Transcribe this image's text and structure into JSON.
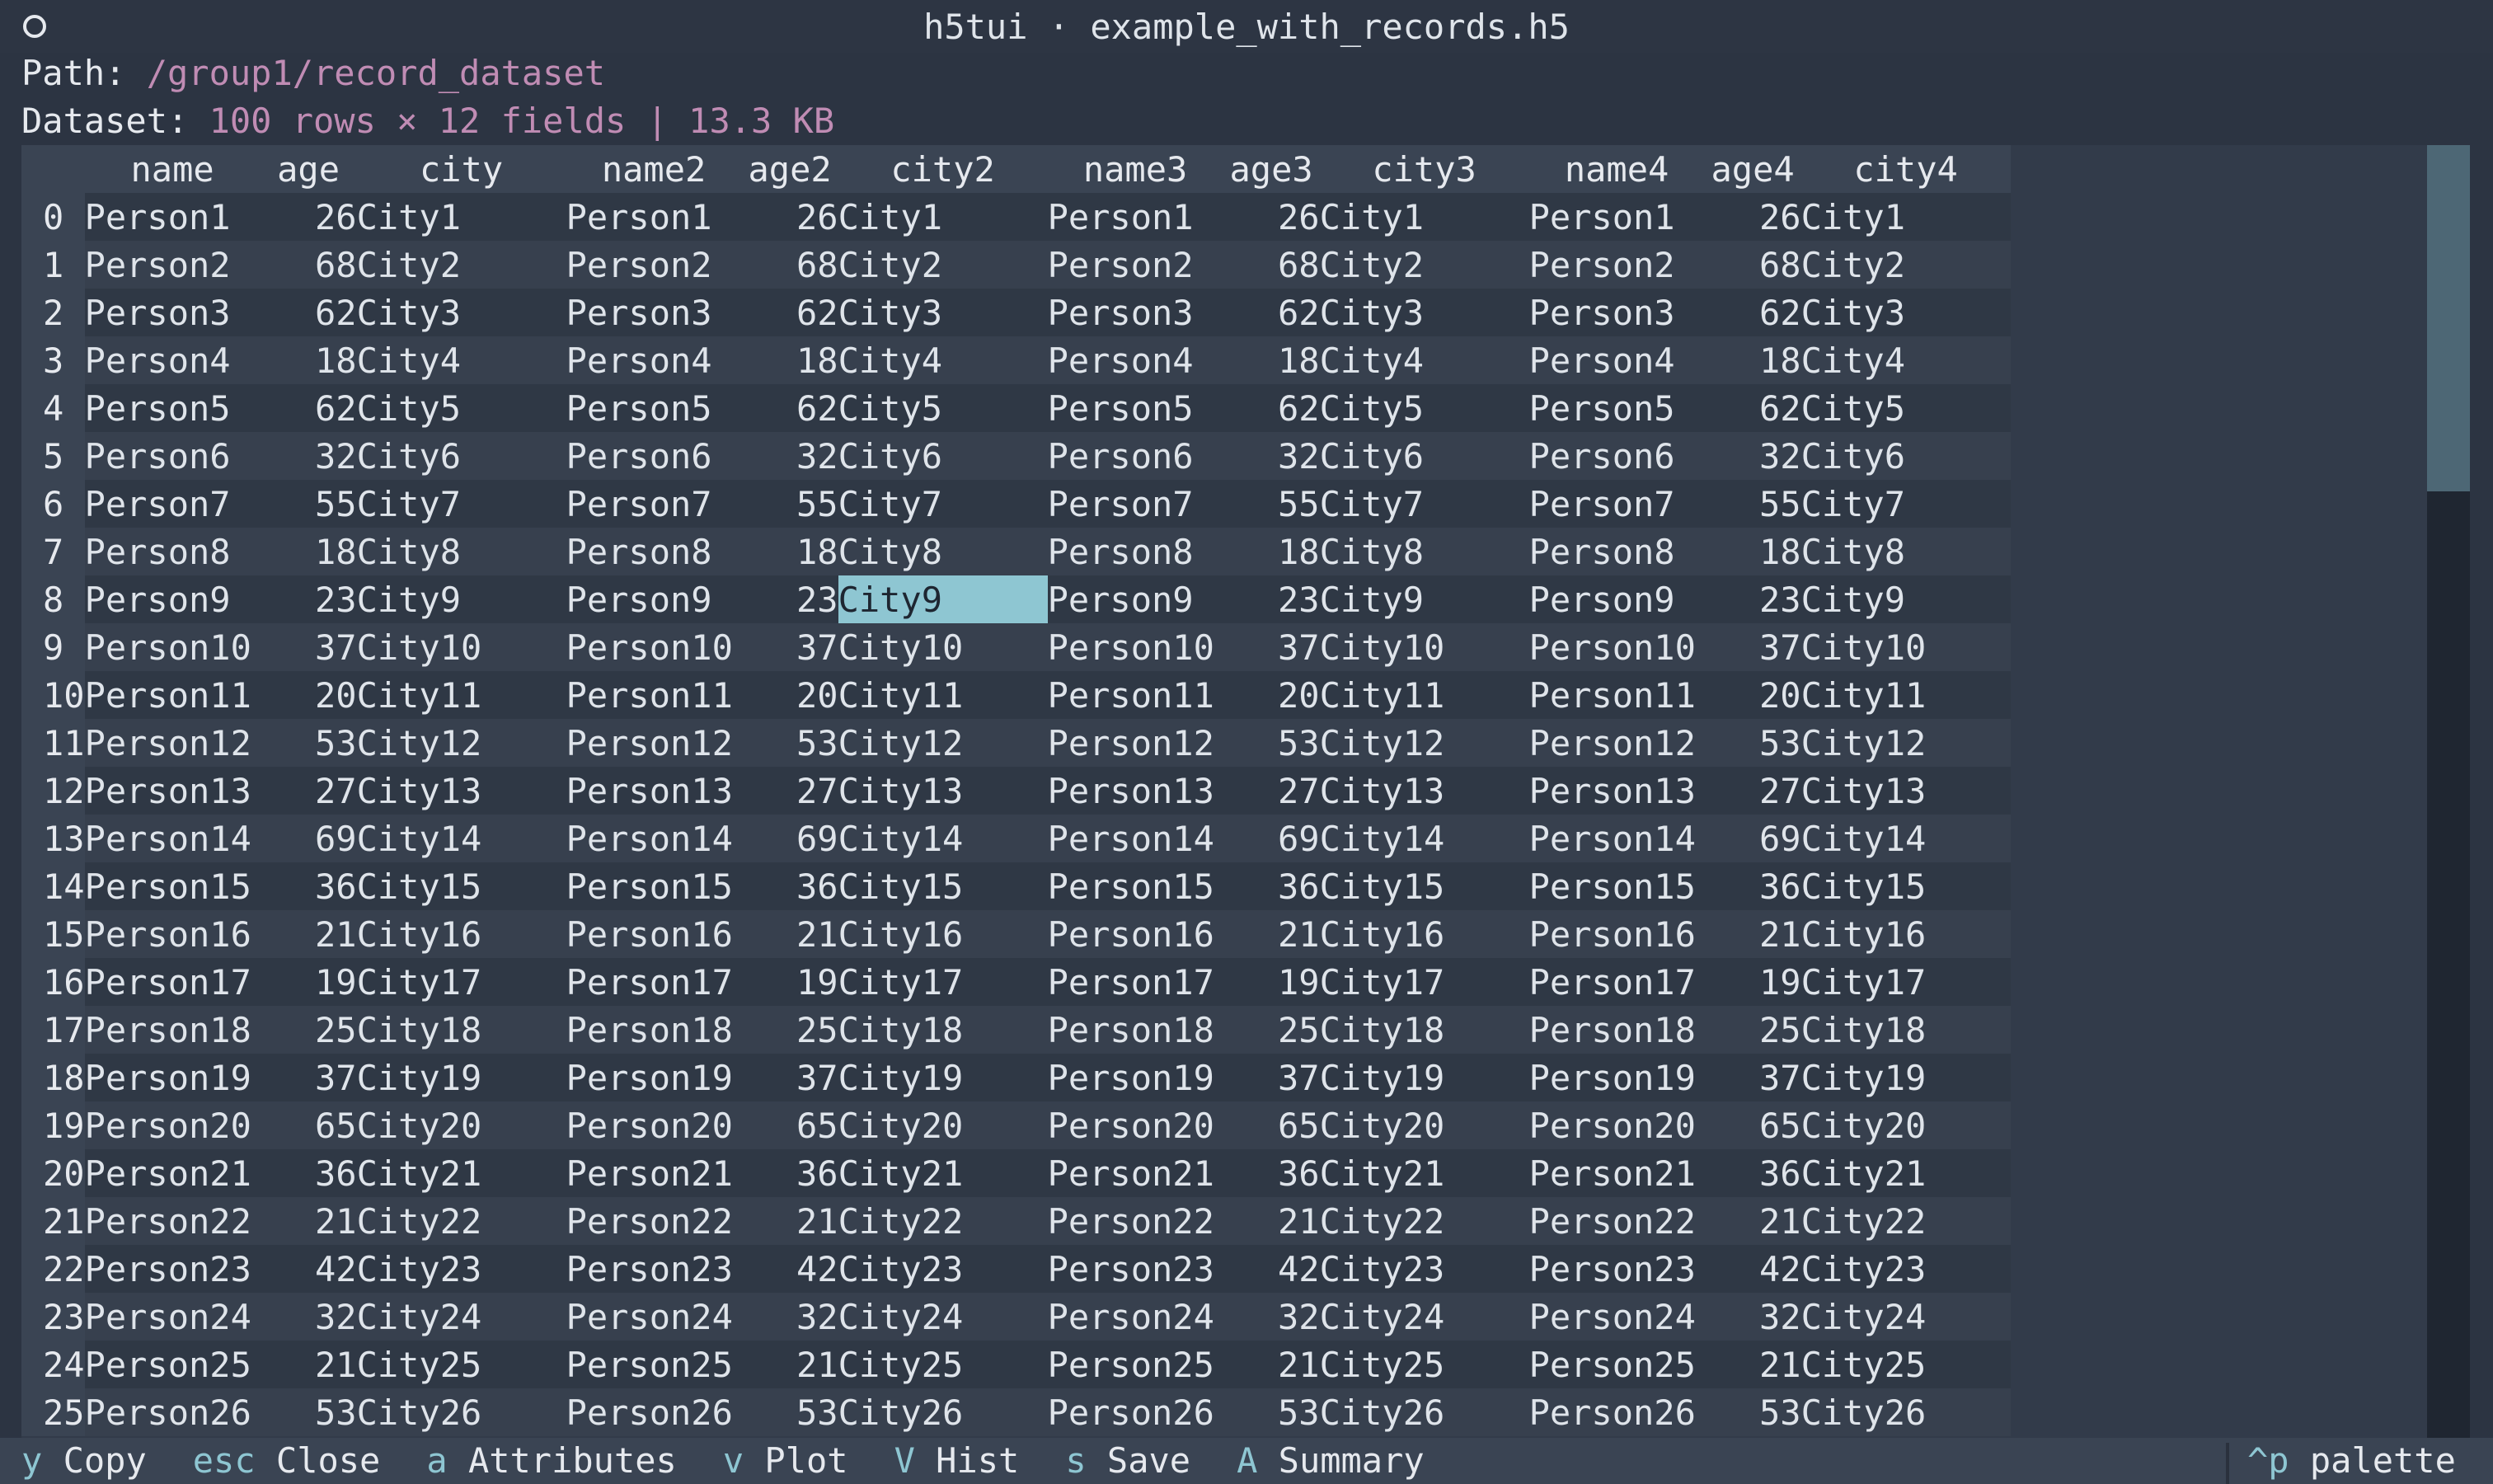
{
  "window": {
    "title": "h5tui · example_with_records.h5"
  },
  "info": {
    "path_label": "Path:",
    "path_value": "/group1/record_dataset",
    "dataset_label": "Dataset:",
    "dataset_value": "100 rows × 12 fields | 13.3 KB"
  },
  "table": {
    "columns": [
      "name",
      "age",
      "city",
      "name2",
      "age2",
      "city2",
      "name3",
      "age3",
      "city3",
      "name4",
      "age4",
      "city4"
    ],
    "selected": {
      "row": 8,
      "column": "city2"
    },
    "rows": [
      [
        "0",
        "Person1",
        "26",
        "City1"
      ],
      [
        "1",
        "Person2",
        "68",
        "City2"
      ],
      [
        "2",
        "Person3",
        "62",
        "City3"
      ],
      [
        "3",
        "Person4",
        "18",
        "City4"
      ],
      [
        "4",
        "Person5",
        "62",
        "City5"
      ],
      [
        "5",
        "Person6",
        "32",
        "City6"
      ],
      [
        "6",
        "Person7",
        "55",
        "City7"
      ],
      [
        "7",
        "Person8",
        "18",
        "City8"
      ],
      [
        "8",
        "Person9",
        "23",
        "City9"
      ],
      [
        "9",
        "Person10",
        "37",
        "City10"
      ],
      [
        "10",
        "Person11",
        "20",
        "City11"
      ],
      [
        "11",
        "Person12",
        "53",
        "City12"
      ],
      [
        "12",
        "Person13",
        "27",
        "City13"
      ],
      [
        "13",
        "Person14",
        "69",
        "City14"
      ],
      [
        "14",
        "Person15",
        "36",
        "City15"
      ],
      [
        "15",
        "Person16",
        "21",
        "City16"
      ],
      [
        "16",
        "Person17",
        "19",
        "City17"
      ],
      [
        "17",
        "Person18",
        "25",
        "City18"
      ],
      [
        "18",
        "Person19",
        "37",
        "City19"
      ],
      [
        "19",
        "Person20",
        "65",
        "City20"
      ],
      [
        "20",
        "Person21",
        "36",
        "City21"
      ],
      [
        "21",
        "Person22",
        "21",
        "City22"
      ],
      [
        "22",
        "Person23",
        "42",
        "City23"
      ],
      [
        "23",
        "Person24",
        "32",
        "City24"
      ],
      [
        "24",
        "Person25",
        "21",
        "City25"
      ],
      [
        "25",
        "Person26",
        "53",
        "City26"
      ]
    ]
  },
  "footer": {
    "bindings": [
      {
        "key": "y",
        "action": "Copy"
      },
      {
        "key": "esc",
        "action": "Close"
      },
      {
        "key": "a",
        "action": "Attributes"
      },
      {
        "key": "v",
        "action": "Plot"
      },
      {
        "key": "V",
        "action": "Hist"
      },
      {
        "key": "s",
        "action": "Save"
      },
      {
        "key": "A",
        "action": "Summary"
      }
    ],
    "palette_key": "^p",
    "palette_label": "palette"
  },
  "colors": {
    "background": "#2c3442",
    "accent": "#8ec6d2",
    "path_value": "#c08cb4",
    "selection": "#8ec6d2"
  }
}
